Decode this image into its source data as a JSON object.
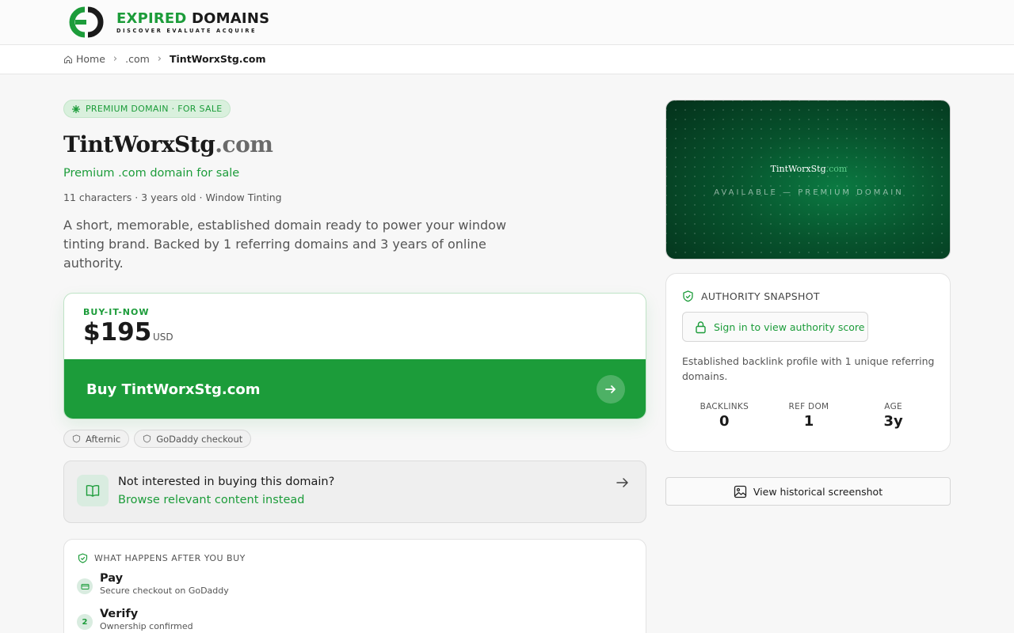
{
  "brand": {
    "name_green": "EXPIRED",
    "name_dark": "DOMAINS",
    "tagline": "DISCOVER EVALUATE ACQUIRE",
    "accent": "#1c9c3a"
  },
  "breadcrumb": {
    "home": "Home",
    "tld": ".com",
    "current": "TintWorxStg.com"
  },
  "hero": {
    "badge": "PREMIUM DOMAIN · FOR SALE",
    "domain_name": "TintWorxStg",
    "domain_tld": ".com",
    "subtitle": "Premium .com domain for sale",
    "meta": "11 characters · 3 years old · Window Tinting",
    "description": "A short, memorable, established domain ready to power your window tinting brand. Backed by 1 referring domains and 3 years of online authority."
  },
  "purchase": {
    "label": "BUY-IT-NOW",
    "price": "$195",
    "currency": "USD",
    "button": "Buy TintWorxStg.com",
    "chips": [
      "Afternic",
      "GoDaddy checkout"
    ]
  },
  "browse": {
    "question": "Not interested in buying this domain?",
    "link": "Browse relevant content instead"
  },
  "after_buy": {
    "heading": "WHAT HAPPENS AFTER YOU BUY",
    "steps": [
      {
        "title": "Pay",
        "sub": "Secure checkout on GoDaddy"
      },
      {
        "num": "2",
        "title": "Verify",
        "sub": "Ownership confirmed"
      }
    ]
  },
  "preview": {
    "name": "TintWorxStg",
    "tld": ".com",
    "caption": "AVAILABLE — PREMIUM DOMAIN"
  },
  "authority": {
    "heading": "AUTHORITY SNAPSHOT",
    "signin": "Sign in to view authority score",
    "description": "Established backlink profile with 1 unique referring domains.",
    "stats": [
      {
        "label": "BACKLINKS",
        "value": "0"
      },
      {
        "label": "REF DOM",
        "value": "1"
      },
      {
        "label": "AGE",
        "value": "3y"
      }
    ]
  },
  "history": {
    "button": "View historical screenshot"
  },
  "icons": [
    "home-icon",
    "chevron-right-icon",
    "sparkle-icon",
    "arrow-right-icon",
    "shield-icon",
    "book-icon",
    "card-icon",
    "lock-icon",
    "image-icon"
  ]
}
